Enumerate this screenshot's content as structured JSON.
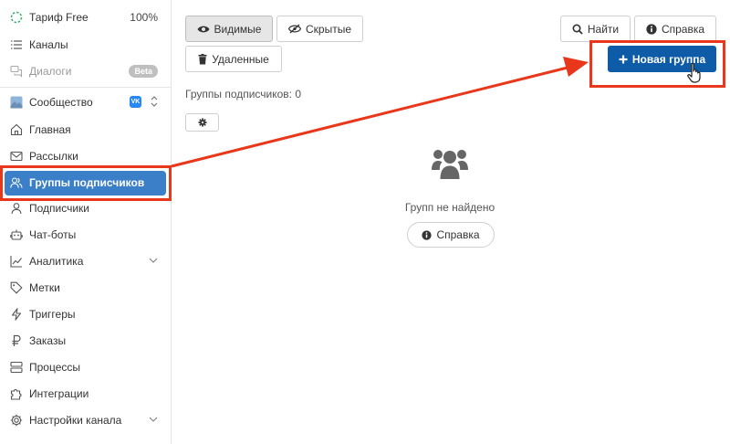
{
  "sidebar": {
    "tariff": {
      "label": "Тариф Free",
      "percent": "100%"
    },
    "channels": "Каналы",
    "dialogs": {
      "label": "Диалоги",
      "badge": "Beta"
    },
    "community": {
      "label": "Сообщество",
      "network_badge": "VK"
    },
    "items": [
      {
        "label": "Главная"
      },
      {
        "label": "Рассылки"
      },
      {
        "label": "Группы подписчиков"
      },
      {
        "label": "Подписчики"
      },
      {
        "label": "Чат-боты"
      },
      {
        "label": "Аналитика"
      },
      {
        "label": "Метки"
      },
      {
        "label": "Триггеры"
      },
      {
        "label": "Заказы"
      },
      {
        "label": "Процессы"
      },
      {
        "label": "Интеграции"
      },
      {
        "label": "Настройки канала"
      }
    ]
  },
  "toolbar": {
    "visible": "Видимые",
    "hidden": "Скрытые",
    "deleted": "Удаленные",
    "find": "Найти",
    "help": "Справка",
    "new_group": "Новая группа"
  },
  "main": {
    "groups_count": "Группы подписчиков: 0",
    "empty_text": "Групп не найдено",
    "help_button": "Справка"
  },
  "colors": {
    "accent": "#3a7fc7",
    "primary": "#0e5ca8",
    "annotation": "#e8371a"
  }
}
